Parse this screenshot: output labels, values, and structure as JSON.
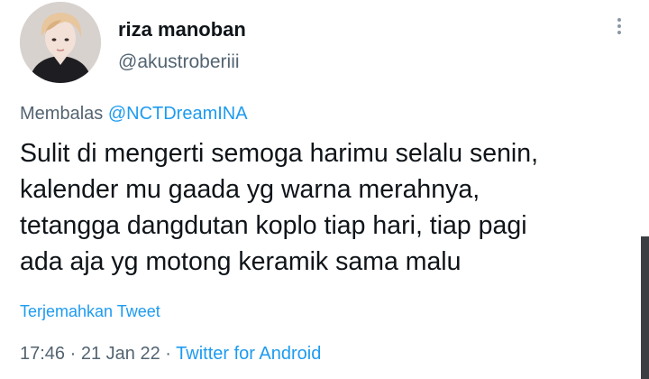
{
  "user": {
    "display_name": "riza manoban",
    "handle": "@akustroberiii"
  },
  "reply": {
    "prefix": "Membalas",
    "mention": "@NCTDreamINA"
  },
  "tweet": {
    "lines": [
      "Sulit di mengerti semoga harimu selalu senin,",
      "kalender mu gaada yg warna merahnya,",
      "tetangga dangdutan koplo tiap hari, tiap pagi",
      "ada aja yg motong keramik sama malu"
    ],
    "translate_label": "Terjemahkan Tweet"
  },
  "meta": {
    "time": "17:46",
    "separator": "·",
    "date": "21 Jan 22",
    "source": "Twitter for Android"
  },
  "icons": {
    "more": "more-vertical-icon",
    "avatar": "avatar"
  },
  "colors": {
    "link": "#1d9bf0",
    "secondary_text": "#536471",
    "primary_text": "#0f1419"
  }
}
